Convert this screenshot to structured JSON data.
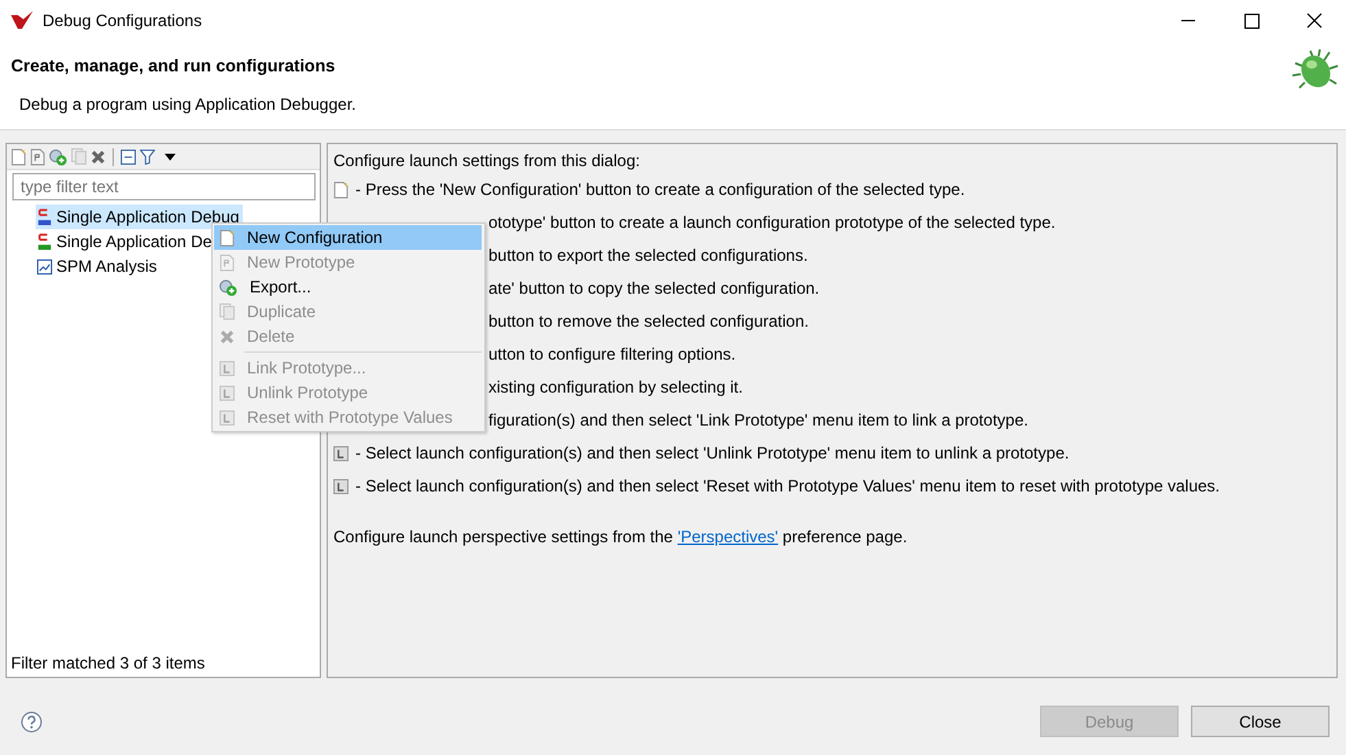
{
  "window": {
    "title": "Debug Configurations"
  },
  "header": {
    "title": "Create, manage, and run configurations",
    "subtitle": "Debug a program using Application Debugger."
  },
  "filter": {
    "placeholder": "type filter text"
  },
  "tree": [
    {
      "label": "Single Application Debug",
      "selected": true
    },
    {
      "label": "Single Application De",
      "selected": false
    },
    {
      "label": "SPM Analysis",
      "selected": false
    }
  ],
  "filter_status": "Filter matched 3 of 3 items",
  "help": {
    "intro": "Configure launch settings from this dialog:",
    "lines": [
      {
        "kind": "full",
        "text": "- Press the 'New Configuration' button to create a configuration of the selected type."
      },
      {
        "kind": "covered",
        "text": "ototype' button to create a launch configuration prototype of the selected type."
      },
      {
        "kind": "covered",
        "text": "button to export the selected configurations."
      },
      {
        "kind": "covered",
        "text": "ate' button to copy the selected configuration."
      },
      {
        "kind": "covered",
        "text": "button to remove the selected configuration."
      },
      {
        "kind": "covered",
        "text": "utton to configure filtering options."
      },
      {
        "kind": "covered",
        "text": "xisting configuration by selecting it."
      },
      {
        "kind": "covered",
        "text": "figuration(s) and then select 'Link Prototype' menu item to link a prototype."
      },
      {
        "kind": "full",
        "text": "- Select launch configuration(s) and then select 'Unlink Prototype' menu item to unlink a prototype."
      },
      {
        "kind": "full",
        "text": "- Select launch configuration(s) and then select 'Reset with Prototype Values' menu item to reset with prototype values."
      }
    ],
    "perspective_before": "Configure launch perspective settings from the ",
    "perspective_link": "'Perspectives'",
    "perspective_after": " preference page."
  },
  "context_menu": [
    {
      "kind": "item",
      "label": "New Configuration",
      "selected": true,
      "disabled": false
    },
    {
      "kind": "item",
      "label": "New Prototype",
      "selected": false,
      "disabled": true
    },
    {
      "kind": "item",
      "label": "Export...",
      "selected": false,
      "disabled": false
    },
    {
      "kind": "item",
      "label": "Duplicate",
      "selected": false,
      "disabled": true
    },
    {
      "kind": "item",
      "label": "Delete",
      "selected": false,
      "disabled": true
    },
    {
      "kind": "separator"
    },
    {
      "kind": "item",
      "label": "Link Prototype...",
      "selected": false,
      "disabled": true
    },
    {
      "kind": "item",
      "label": "Unlink Prototype",
      "selected": false,
      "disabled": true
    },
    {
      "kind": "item",
      "label": "Reset with Prototype Values",
      "selected": false,
      "disabled": true
    }
  ],
  "buttons": [
    {
      "label": "Debug",
      "disabled": true
    },
    {
      "label": "Close",
      "disabled": false
    }
  ]
}
